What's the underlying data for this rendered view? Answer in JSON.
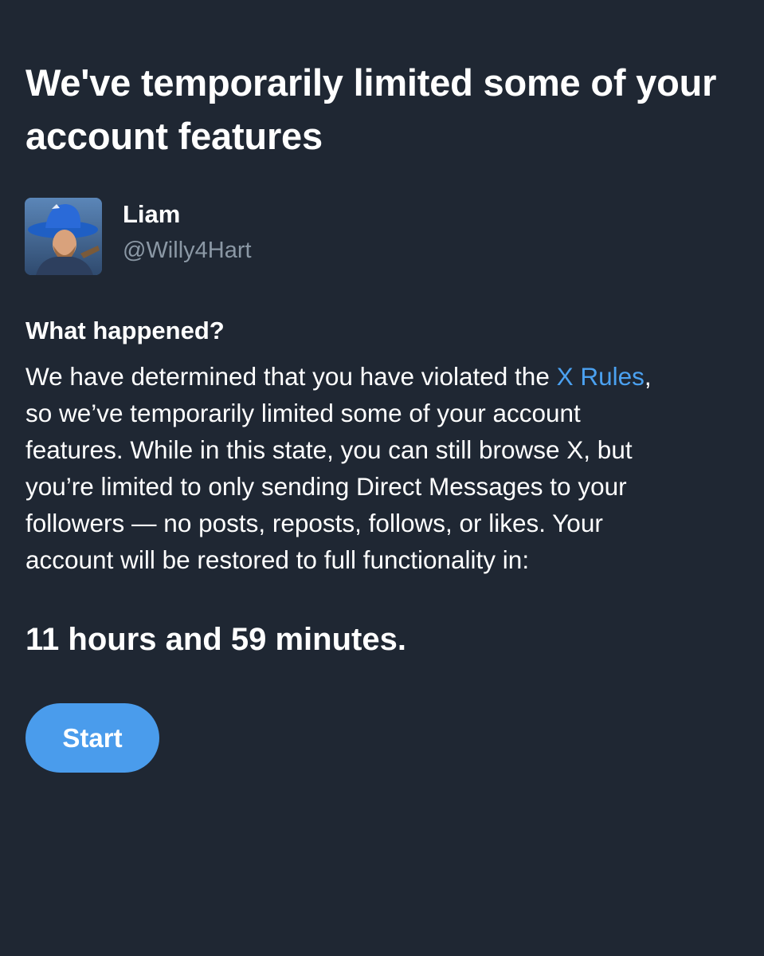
{
  "title": "We've temporarily limited some of your account features",
  "profile": {
    "display_name": "Liam",
    "handle": "@Willy4Hart"
  },
  "section": {
    "heading": "What happened?",
    "line_1_before": "We have determined that you have violated the ",
    "rules_link": "X Rules",
    "line_1_after": ",",
    "line_2": "so we’ve temporarily limited some of your account",
    "line_3": "features. While in this state, you can still browse X, but",
    "line_4": "you’re limited to only sending Direct Messages to your",
    "line_5": "followers — no posts, reposts, follows, or likes. Your",
    "line_6": "account will be restored to full functionality in:"
  },
  "countdown": "11 hours and 59 minutes.",
  "start_button_label": "Start",
  "colors": {
    "background": "#1f2733",
    "text_primary": "#ffffff",
    "text_secondary": "#8b98a5",
    "link": "#4ba1f0",
    "button": "#4a9cec"
  }
}
